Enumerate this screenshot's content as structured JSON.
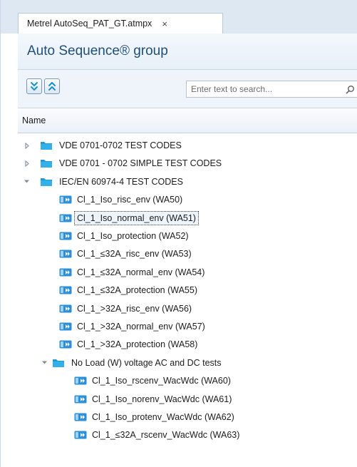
{
  "tab": {
    "label": "Metrel AutoSeq_PAT_GT.atmpx",
    "close": "×"
  },
  "group": {
    "title": "Auto Sequence® group"
  },
  "toolbar": {
    "expand_icon": "expand-all-icon",
    "collapse_icon": "collapse-all-icon",
    "search_placeholder": "Enter text to search...",
    "search_value": ""
  },
  "columns": {
    "name": "Name"
  },
  "colors": {
    "folder": "#1e9ad6",
    "item": "#2a8fd8",
    "title": "#1f4e79"
  },
  "tree": [
    {
      "label": "VDE 0701-0702 TEST CODES",
      "type": "folder",
      "level": 0,
      "state": "collapsed"
    },
    {
      "label": "VDE 0701 - 0702 SIMPLE TEST CODES",
      "type": "folder",
      "level": 0,
      "state": "collapsed"
    },
    {
      "label": "IEC/EN 60974-4 TEST CODES",
      "type": "folder",
      "level": 0,
      "state": "expanded"
    },
    {
      "label": "Cl_1_Iso_risc_env (WA50)",
      "type": "item",
      "level": 1
    },
    {
      "label": "Cl_1_Iso_normal_env (WA51)",
      "type": "item",
      "level": 1,
      "selected": true
    },
    {
      "label": "Cl_1_Iso_protection (WA52)",
      "type": "item",
      "level": 1
    },
    {
      "label": "Cl_1_≤32A_risc_env (WA53)",
      "type": "item",
      "level": 1
    },
    {
      "label": "Cl_1_≤32A_normal_env (WA54)",
      "type": "item",
      "level": 1
    },
    {
      "label": "Cl_1_≤32A_protection (WA55)",
      "type": "item",
      "level": 1
    },
    {
      "label": "Cl_1_>32A_risc_env (WA56)",
      "type": "item",
      "level": 1
    },
    {
      "label": "Cl_1_>32A_normal_env (WA57)",
      "type": "item",
      "level": 1
    },
    {
      "label": "Cl_1_>32A_protection (WA58)",
      "type": "item",
      "level": 1
    },
    {
      "label": "No Load (W) voltage  AC and DC tests",
      "type": "folder",
      "level": 1,
      "state": "expanded"
    },
    {
      "label": "Cl_1_Iso_rscenv_WacWdc (WA60)",
      "type": "item",
      "level": 2
    },
    {
      "label": "Cl_1_Iso_norenv_WacWdc (WA61)",
      "type": "item",
      "level": 2
    },
    {
      "label": "Cl_1_Iso_protenv_WacWdc (WA62)",
      "type": "item",
      "level": 2
    },
    {
      "label": "Cl_1_≤32A_rscenv_WacWdc (WA63)",
      "type": "item",
      "level": 2
    }
  ]
}
